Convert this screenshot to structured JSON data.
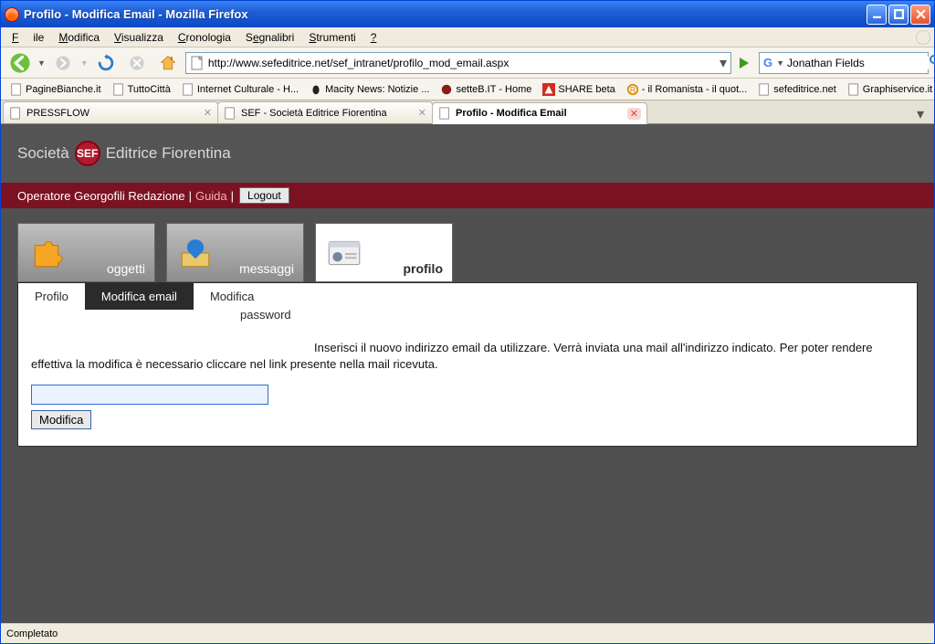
{
  "window": {
    "title": "Profilo - Modifica Email - Mozilla Firefox"
  },
  "menus": [
    "File",
    "Modifica",
    "Visualizza",
    "Cronologia",
    "Segnalibri",
    "Strumenti",
    "?"
  ],
  "url": "http://www.sefeditrice.net/sef_intranet/profilo_mod_email.aspx",
  "search": {
    "value": "Jonathan Fields"
  },
  "bookmarks": [
    "PagineBianche.it",
    "TuttoCittà",
    "Internet Culturale - H...",
    "Macity News: Notizie ...",
    "setteB.IT - Home",
    "SHARE beta",
    "- il Romanista - il quot...",
    "sefeditrice.net",
    "Graphiservice.it"
  ],
  "tabs": [
    {
      "label": "PRESSFLOW",
      "active": false
    },
    {
      "label": "SEF - Società Editrice Fiorentina",
      "active": false
    },
    {
      "label": "Profilo - Modifica Email",
      "active": true
    }
  ],
  "brand": {
    "left": "Società",
    "right": "Editrice Fiorentina",
    "logo": "SEF"
  },
  "maroon": {
    "operator": "Operatore Georgofili Redazione",
    "guide": "Guida",
    "logout": "Logout"
  },
  "cards": [
    {
      "label": "oggetti"
    },
    {
      "label": "messaggi"
    },
    {
      "label": "profilo"
    }
  ],
  "ptabs": {
    "t1": "Profilo",
    "t2": "Modifica email",
    "t3": "Modifica",
    "t3b": "password"
  },
  "instructions": "Inserisci il nuovo indirizzo email da utilizzare. Verrà inviata una mail all'indirizzo indicato. Per poter rendere effettiva la modifica è necessario cliccare nel link presente nella mail ricevuta.",
  "submit": "Modifica",
  "status": "Completato",
  "bm_more": "»"
}
